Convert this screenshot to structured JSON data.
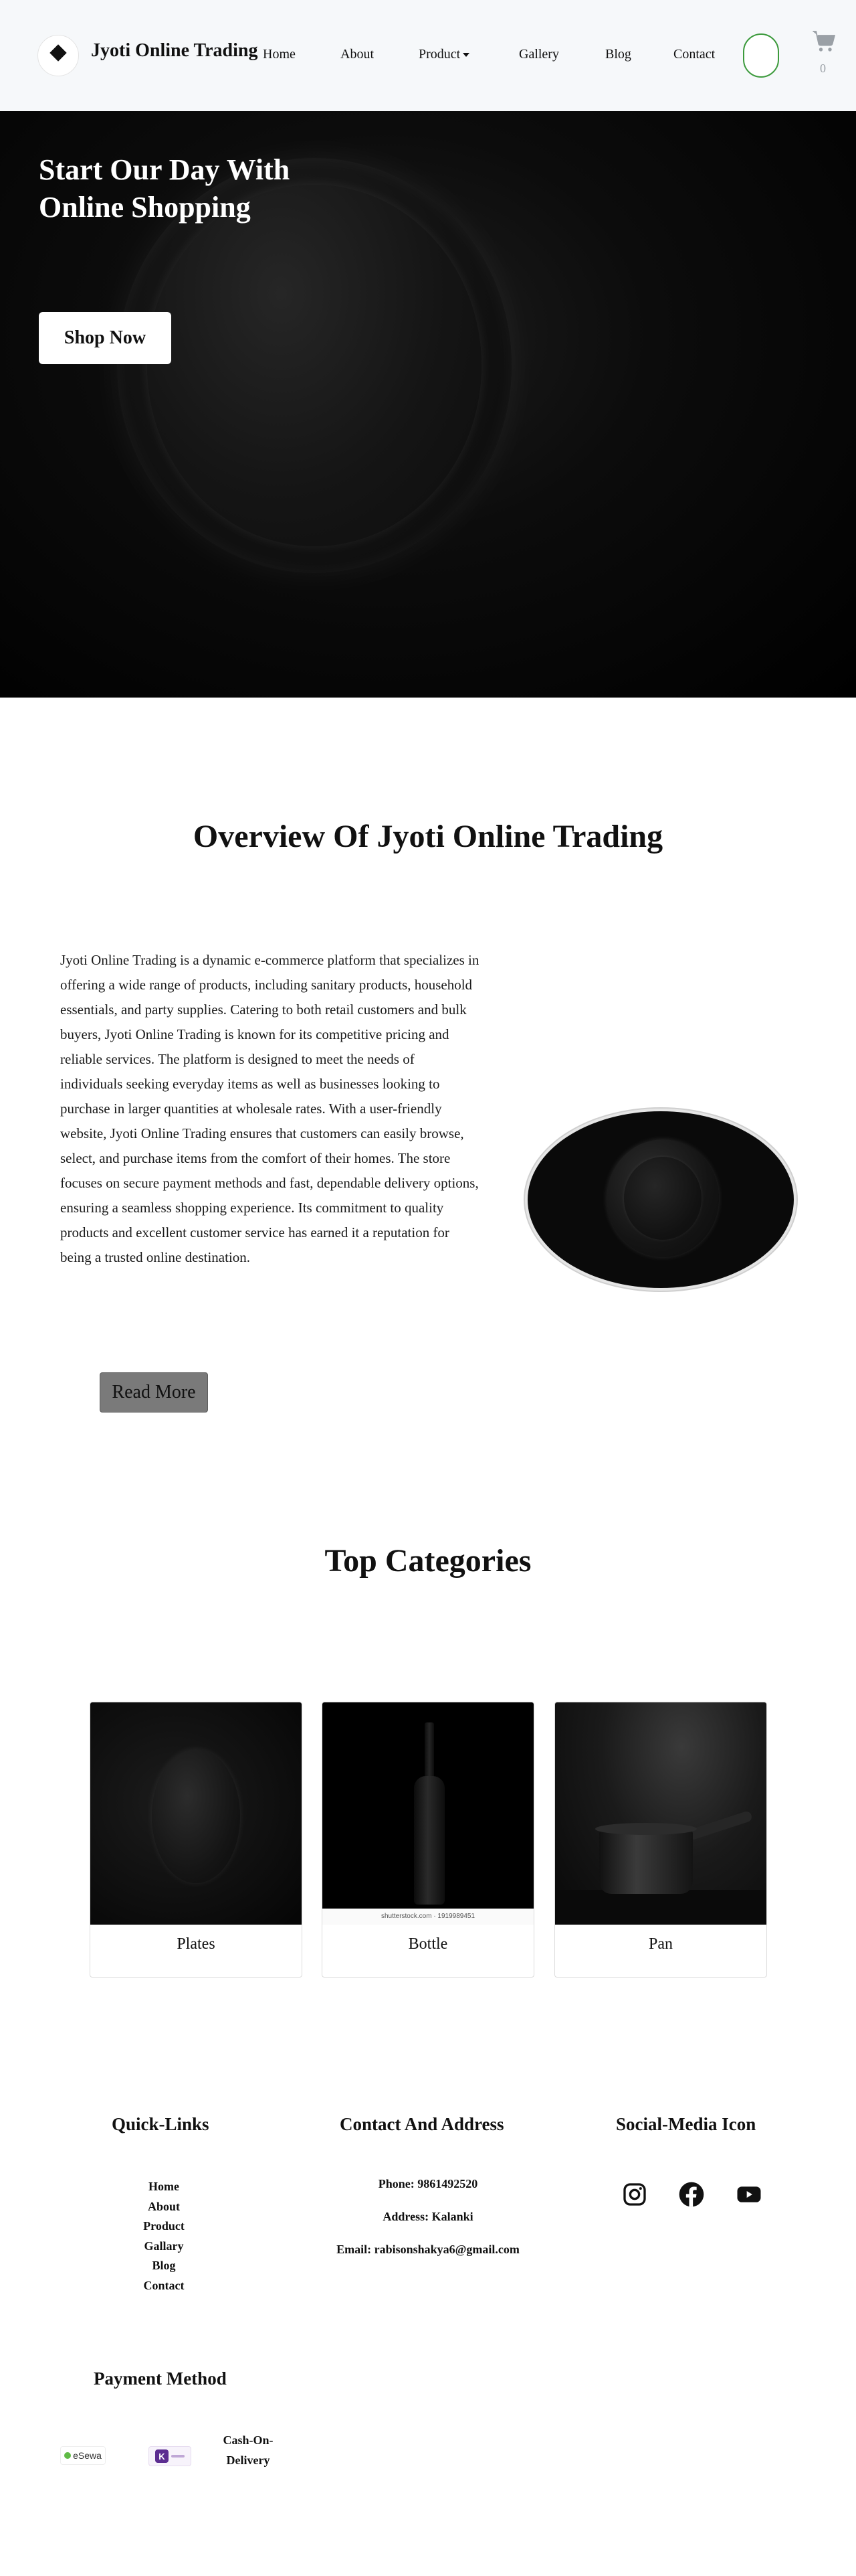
{
  "header": {
    "brand_name": "Jyoti Online Trading",
    "nav": {
      "home": "Home",
      "about": "About",
      "product": "Product",
      "gallery": "Gallery",
      "blog": "Blog",
      "contact": "Contact"
    },
    "cart_count": "0",
    "icons": {
      "logo": "jyoti-logo",
      "cart": "cart-icon",
      "caret": "caret-down-icon"
    }
  },
  "hero": {
    "title": "Start Our Day With Online Shopping",
    "button_label": "Shop Now"
  },
  "overview": {
    "title": "Overview Of Jyoti Online Trading",
    "text": "Jyoti Online Trading is a dynamic e-commerce platform that specializes in offering a wide range of products, including sanitary products, household essentials, and party supplies. Catering to both retail customers and bulk buyers, Jyoti Online Trading is known for its competitive pricing and reliable services. The platform is designed to meet the needs of individuals seeking everyday items as well as businesses looking to purchase in larger quantities at wholesale rates. With a user-friendly website, Jyoti Online Trading ensures that customers can easily browse, select, and purchase items from the comfort of their homes. The store focuses on secure payment methods and fast, dependable delivery options, ensuring a seamless shopping experience. Its commitment to quality products and excellent customer service has earned it a reputation for being a trusted online destination.",
    "read_more_label": "Read More"
  },
  "categories": {
    "title": "Top Categories",
    "items": [
      {
        "label": "Plates"
      },
      {
        "label": "Bottle",
        "image_caption": "shutterstock.com · 1919989451"
      },
      {
        "label": "Pan"
      }
    ]
  },
  "footer": {
    "quick_links": {
      "title": "Quick-Links",
      "links": [
        "Home",
        "About",
        "Product",
        "Gallary",
        "Blog",
        "Contact"
      ]
    },
    "contact": {
      "title": "Contact And Address",
      "phone": "Phone: 9861492520",
      "address": "Address: Kalanki",
      "email": "Email: rabisonshakya6@gmail.com"
    },
    "social": {
      "title": "Social-Media Icon",
      "icons": [
        "instagram-icon",
        "facebook-icon",
        "youtube-icon"
      ]
    },
    "payment": {
      "title": "Payment Method",
      "esewa": "eSewa",
      "khalti": "K",
      "cod": "Cash-On-Delivery"
    }
  },
  "colors": {
    "navbar_bg": "#f6f8fa",
    "search_outline": "#3c9a3c",
    "read_more_bg": "#7a7a7a",
    "hero_bg": "#000000"
  }
}
